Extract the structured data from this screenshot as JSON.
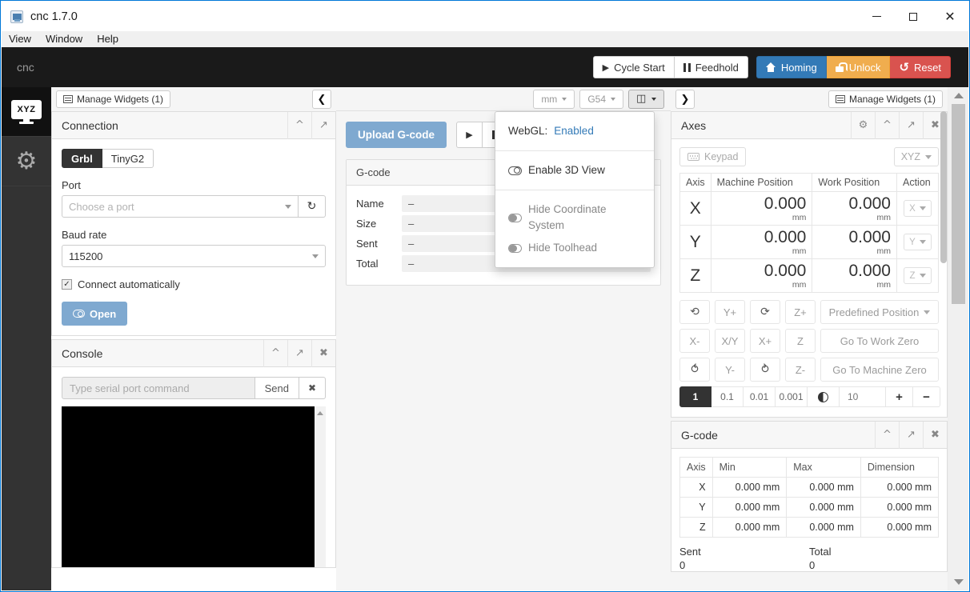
{
  "window": {
    "title": "cnc 1.7.0",
    "app_icon": "cnc-app-icon",
    "controls": {
      "minimize": "minimize",
      "maximize": "maximize",
      "close": "close"
    },
    "menus": [
      "View",
      "Window",
      "Help"
    ]
  },
  "navbar": {
    "brand": "cnc",
    "buttons": [
      {
        "label": "Cycle Start",
        "icon": "play-icon",
        "style": "default"
      },
      {
        "label": "Feedhold",
        "icon": "pause-icon",
        "style": "default"
      },
      {
        "label": "Homing",
        "icon": "home-icon",
        "style": "blue",
        "color": "#337ab7"
      },
      {
        "label": "Unlock",
        "icon": "unlock-icon",
        "style": "orange",
        "color": "#f0ad4e"
      },
      {
        "label": "Reset",
        "icon": "reset-icon",
        "style": "red",
        "color": "#d9534f"
      }
    ]
  },
  "sidebar": {
    "items": [
      {
        "name": "workspace",
        "icon": "xyz-monitor-icon",
        "label": "XYZ",
        "active": true
      },
      {
        "name": "settings",
        "icon": "gears-icon",
        "label": "",
        "active": false
      }
    ]
  },
  "left_column": {
    "manage_widgets": "Manage Widgets (1)",
    "collapse_icon": "chevron-left-icon",
    "connection": {
      "title": "Connection",
      "actions": [
        "chevron-up-icon",
        "expand-icon"
      ],
      "controller_tabs": [
        {
          "label": "Grbl",
          "active": true
        },
        {
          "label": "TinyG2",
          "active": false
        }
      ],
      "port_label": "Port",
      "port_placeholder": "Choose a port",
      "port_value": "",
      "refresh_icon": "refresh-icon",
      "baud_label": "Baud rate",
      "baud_value": "115200",
      "autoconnect_label": "Connect automatically",
      "autoconnect_checked": true,
      "open_button": "Open",
      "open_icon": "toggle-icon",
      "open_color": "#7fa9d0"
    },
    "console": {
      "title": "Console",
      "actions": [
        "chevron-up-icon",
        "expand-icon",
        "close-icon"
      ],
      "input_placeholder": "Type serial port command",
      "input_value": "",
      "send_button": "Send",
      "clear_icon": "close-icon",
      "terminal_content": ""
    }
  },
  "center_column": {
    "toolbar": {
      "units": "mm",
      "wcs": "G54",
      "view_icon": "cube-icon"
    },
    "upload_button": "Upload G-code",
    "upload_color": "#7fa9d0",
    "playback": [
      {
        "name": "run",
        "icon": "play-icon"
      },
      {
        "name": "pause",
        "icon": "pause-icon"
      }
    ],
    "gcode_panel": {
      "title": "G-code",
      "rows": [
        {
          "label": "Name",
          "value": "–"
        },
        {
          "label": "Size",
          "value": "–"
        },
        {
          "label": "Sent",
          "value": "–"
        },
        {
          "label": "Total",
          "value": "–"
        }
      ]
    },
    "view_menu": {
      "webgl_label": "WebGL:",
      "webgl_status": "Enabled",
      "webgl_status_color": "#337ab7",
      "items": [
        {
          "label": "Enable 3D View",
          "toggle": "off"
        },
        {
          "label": "Hide Coordinate System",
          "toggle": "on"
        },
        {
          "label": "Hide Toolhead",
          "toggle": "on"
        }
      ]
    }
  },
  "right_column": {
    "expand_icon": "chevron-right-icon",
    "manage_widgets": "Manage Widgets (1)",
    "axes": {
      "title": "Axes",
      "actions": [
        "gear-icon",
        "chevron-up-icon",
        "expand-icon",
        "close-icon"
      ],
      "keypad_button": "Keypad",
      "keypad_icon": "keyboard-icon",
      "axis_selector": "XYZ",
      "headers": [
        "Axis",
        "Machine Position",
        "Work Position",
        "Action"
      ],
      "rows": [
        {
          "axis": "X",
          "machine": "0.000",
          "machine_unit": "mm",
          "work": "0.000",
          "work_unit": "mm",
          "action": "X"
        },
        {
          "axis": "Y",
          "machine": "0.000",
          "machine_unit": "mm",
          "work": "0.000",
          "work_unit": "mm",
          "action": "Y"
        },
        {
          "axis": "Z",
          "machine": "0.000",
          "machine_unit": "mm",
          "work": "0.000",
          "work_unit": "mm",
          "action": "Z"
        }
      ],
      "jog": {
        "row1": [
          "rotate-ccw-up-icon",
          "Y+",
          "rotate-cw-up-icon",
          "Z+"
        ],
        "row1_action": "Predefined Position",
        "row2": [
          "X-",
          "X/Y",
          "X+",
          "Z"
        ],
        "row2_action": "Go To Work Zero",
        "row3": [
          "rotate-ccw-down-icon",
          "Y-",
          "rotate-cw-down-icon",
          "Z-"
        ],
        "row3_action": "Go To Machine Zero",
        "steps": [
          "1",
          "0.1",
          "0.01",
          "0.001"
        ],
        "active_step": "1",
        "contrast_icon": "half-circle-icon",
        "feedrate": "10",
        "plus": "+",
        "minus": "−"
      }
    },
    "gcode": {
      "title": "G-code",
      "actions": [
        "chevron-up-icon",
        "expand-icon",
        "close-icon"
      ],
      "headers": [
        "Axis",
        "Min",
        "Max",
        "Dimension"
      ],
      "rows": [
        {
          "axis": "X",
          "min": "0.000 mm",
          "max": "0.000 mm",
          "dimension": "0.000 mm"
        },
        {
          "axis": "Y",
          "min": "0.000 mm",
          "max": "0.000 mm",
          "dimension": "0.000 mm"
        },
        {
          "axis": "Z",
          "min": "0.000 mm",
          "max": "0.000 mm",
          "dimension": "0.000 mm"
        }
      ],
      "sent_label": "Sent",
      "sent_value": "0",
      "total_label": "Total",
      "total_value": "0"
    }
  }
}
